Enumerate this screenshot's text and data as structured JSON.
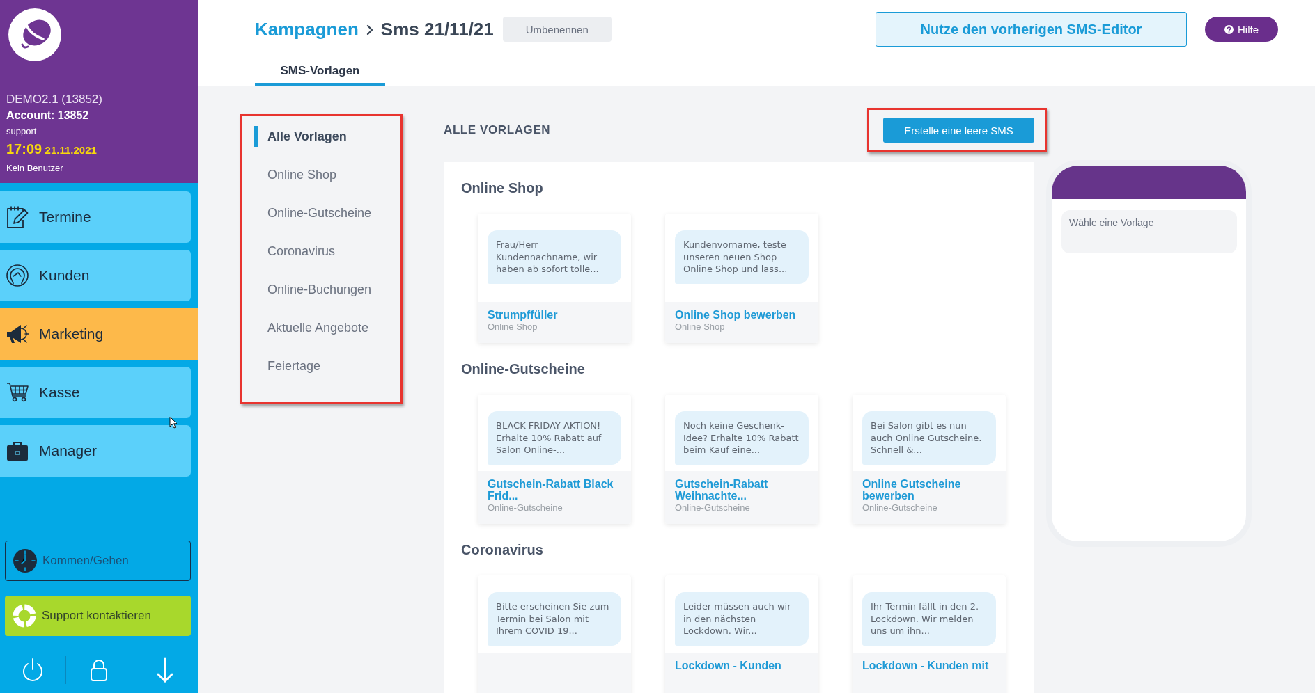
{
  "sidebar": {
    "account": {
      "company": "DEMO2.1 (13852)",
      "account": "Account: 13852",
      "user": "support",
      "time": "17:09",
      "date": "21.11.2021",
      "status": "Kein Benutzer"
    },
    "nav_items": [
      {
        "label": "Termine",
        "selected": false
      },
      {
        "label": "Kunden",
        "selected": false
      },
      {
        "label": "Marketing",
        "selected": true
      },
      {
        "label": "Kasse",
        "selected": false
      },
      {
        "label": "Manager",
        "selected": false
      }
    ],
    "actions": [
      {
        "label": "Kommen/Gehen",
        "kind": "outline"
      },
      {
        "label": "Support kontaktieren",
        "kind": "solid"
      }
    ]
  },
  "header": {
    "breadcrumb": [
      {
        "label": "Kampagnen",
        "kind": "link"
      },
      {
        "label": "Sms 21/11/21",
        "kind": "current"
      }
    ],
    "rename_button": "Umbenennen",
    "legacy_editor_button": "Nutze den vorherigen SMS-Editor",
    "help_button": "Hilfe"
  },
  "tabs": [
    {
      "label": "SMS-Vorlagen",
      "selected": true
    }
  ],
  "category_nav": {
    "highlighted": true,
    "items": [
      {
        "label": "Alle Vorlagen",
        "selected": true
      },
      {
        "label": "Online Shop",
        "selected": false
      },
      {
        "label": "Online-Gutscheine",
        "selected": false
      },
      {
        "label": "Coronavirus",
        "selected": false
      },
      {
        "label": "Online-Buchungen",
        "selected": false
      },
      {
        "label": "Aktuelle Angebote",
        "selected": false
      },
      {
        "label": "Feiertage",
        "selected": false
      }
    ]
  },
  "templates": {
    "heading": "ALLE VORLAGEN",
    "create_button": {
      "label": "Erstelle eine leere SMS",
      "highlighted": true
    },
    "sections": [
      {
        "title": "Online Shop",
        "cards": [
          {
            "preview": "Frau/Herr Kundennachname, wir haben ab sofort tolle...",
            "title": "Strumpffüller",
            "category": "Online Shop"
          },
          {
            "preview": "Kundenvorname, teste unseren neuen Shop Online Shop und lass...",
            "title": "Online Shop bewerben",
            "category": "Online Shop"
          }
        ]
      },
      {
        "title": "Online-Gutscheine",
        "cards": [
          {
            "preview": "BLACK FRIDAY AKTION! Erhalte 10% Rabatt auf Salon Online-...",
            "title": "Gutschein-Rabatt Black Frid...",
            "category": "Online-Gutscheine"
          },
          {
            "preview": "Noch keine Geschenk-Idee? Erhalte 10% Rabatt beim Kauf eine...",
            "title": "Gutschein-Rabatt Weihnachte...",
            "category": "Online-Gutscheine"
          },
          {
            "preview": "Bei Salon gibt es nun auch Online Gutscheine. Schnell &...",
            "title": "Online Gutscheine bewerben",
            "category": "Online-Gutscheine"
          }
        ]
      },
      {
        "title": "Coronavirus",
        "cards": [
          {
            "preview": "Bitte erscheinen Sie zum Termin bei Salon mit Ihrem COVID 19..."
          },
          {
            "preview": "Leider müssen auch wir in den nächsten Lockdown. Wir...",
            "title": "Lockdown - Kunden"
          },
          {
            "preview": "Ihr Termin fällt in den 2. Lockdown. Wir melden uns um ihn...",
            "title": "Lockdown - Kunden mit"
          }
        ]
      }
    ]
  },
  "preview": {
    "message": "Wähle eine Vorlage"
  }
}
